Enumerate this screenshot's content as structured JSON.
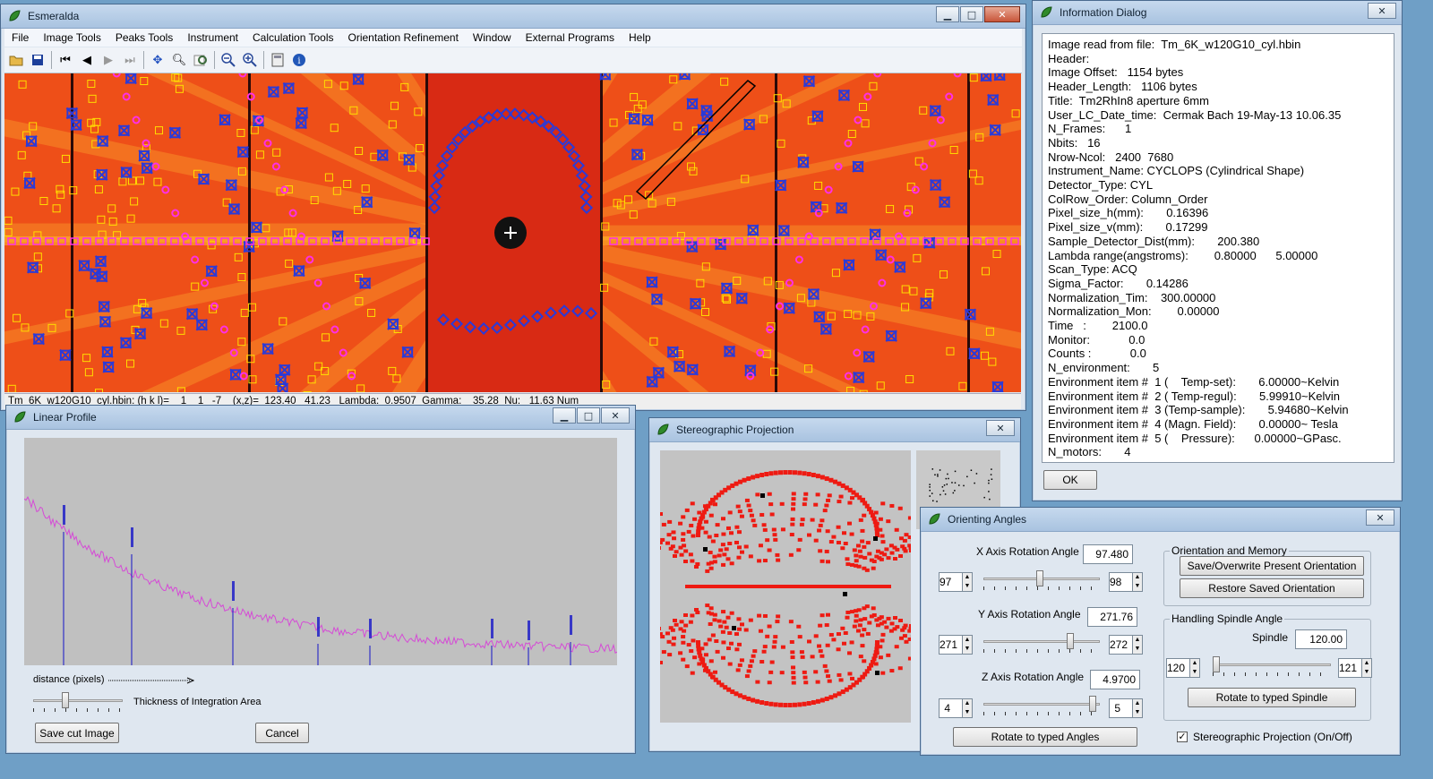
{
  "main_window": {
    "title": "Esmeralda",
    "menu": [
      "File",
      "Image Tools",
      "Peaks Tools",
      "Instrument",
      "Calculation Tools",
      "Orientation Refinement",
      "Window",
      "External Programs",
      "Help"
    ],
    "toolbar_icons": [
      "open-folder-icon",
      "save-icon",
      "first-icon",
      "prev-icon",
      "next-icon",
      "last-icon",
      "move-icon",
      "zoom-icon",
      "find-icon",
      "zoom-out-icon",
      "zoom-in-icon",
      "calculator-icon",
      "info-icon"
    ],
    "status_text": "Tm_6K_w120G10_cyl.hbin: (h k l)=    1    1   -7    (x,z)=  123.40   41.23   Lambda:  0.9507  Gamma:    35.28  Nu:   11.63 Num",
    "colors": {
      "image_bg": "#e8321a",
      "peak_box": "#ffdd00",
      "peak_x": "#2b3ad8",
      "peak_pink": "#ff2fe6"
    }
  },
  "linear_profile": {
    "title": "Linear Profile",
    "axis_label": "distance (pixels)",
    "thickness_label": "Thickness of Integration Area",
    "save_button": "Save cut Image",
    "cancel_button": "Cancel",
    "colors": {
      "plot_bg": "#c0c0c0",
      "profile": "#d54bd6",
      "marker": "#1515c8"
    }
  },
  "stereographic": {
    "title": "Stereographic Projection",
    "colors": {
      "points": "#ee1a12",
      "bg": "#c3c3c3"
    }
  },
  "info_dialog": {
    "title": "Information Dialog",
    "lines": [
      "Image read from file:  Tm_6K_w120G10_cyl.hbin",
      "Header:",
      "Image Offset:   1154 bytes",
      "Header_Length:   1106 bytes",
      "Title:  Tm2RhIn8 aperture 6mm",
      "User_LC_Date_time:  Cermak Bach 19-May-13 10.06.35",
      "N_Frames:      1",
      "Nbits:   16",
      "Nrow-Ncol:   2400  7680",
      "Instrument_Name: CYCLOPS (Cylindrical Shape)",
      "Detector_Type: CYL",
      "ColRow_Order: Column_Order",
      "Pixel_size_h(mm):       0.16396",
      "Pixel_size_v(mm):       0.17299",
      "Sample_Detector_Dist(mm):       200.380",
      "Lambda range(angstroms):        0.80000      5.00000",
      "Scan_Type: ACQ",
      "Sigma_Factor:       0.14286",
      "Normalization_Tim:    300.00000",
      "Normalization_Mon:        0.00000",
      "Time   :        2100.0",
      "Monitor:            0.0",
      "Counts :            0.0",
      "N_environment:       5",
      "Environment item #  1 (    Temp-set):       6.00000~Kelvin",
      "Environment item #  2 ( Temp-regul):       5.99910~Kelvin",
      "Environment item #  3 (Temp-sample):       5.94680~Kelvin",
      "Environment item #  4 (Magn. Field):       0.00000~ Tesla",
      "Environment item #  5 (    Pressure):      0.00000~GPasc.",
      "N_motors:       4"
    ],
    "ok_button": "OK"
  },
  "orienting_angles": {
    "title": "Orienting Angles",
    "x_label": "X Axis Rotation  Angle",
    "x_value": "97.480",
    "x_min": "97",
    "x_max": "98",
    "x_position": 0.48,
    "y_label": "Y Axis Rotation Angle",
    "y_value": "271.76",
    "y_min": "271",
    "y_max": "272",
    "y_position": 0.76,
    "z_label": "Z Axis Rotation Angle",
    "z_value": "4.9700",
    "z_min": "4",
    "z_max": "5",
    "z_position": 0.97,
    "rotate_angles_button": "Rotate to typed Angles",
    "orientation_memory_title": "Orientation and Memory",
    "save_orientation_button": "Save/Overwrite Present Orientation",
    "restore_orientation_button": "Restore Saved Orientation",
    "spindle_group_title": "Handling Spindle Angle",
    "spindle_label": "Spindle",
    "spindle_value": "120.00",
    "spindle_min": "120",
    "spindle_max": "121",
    "spindle_position": 0.0,
    "rotate_spindle_button": "Rotate to typed Spindle",
    "stereo_checkbox_label": "Stereographic Projection (On/Off)",
    "stereo_checked": true
  }
}
